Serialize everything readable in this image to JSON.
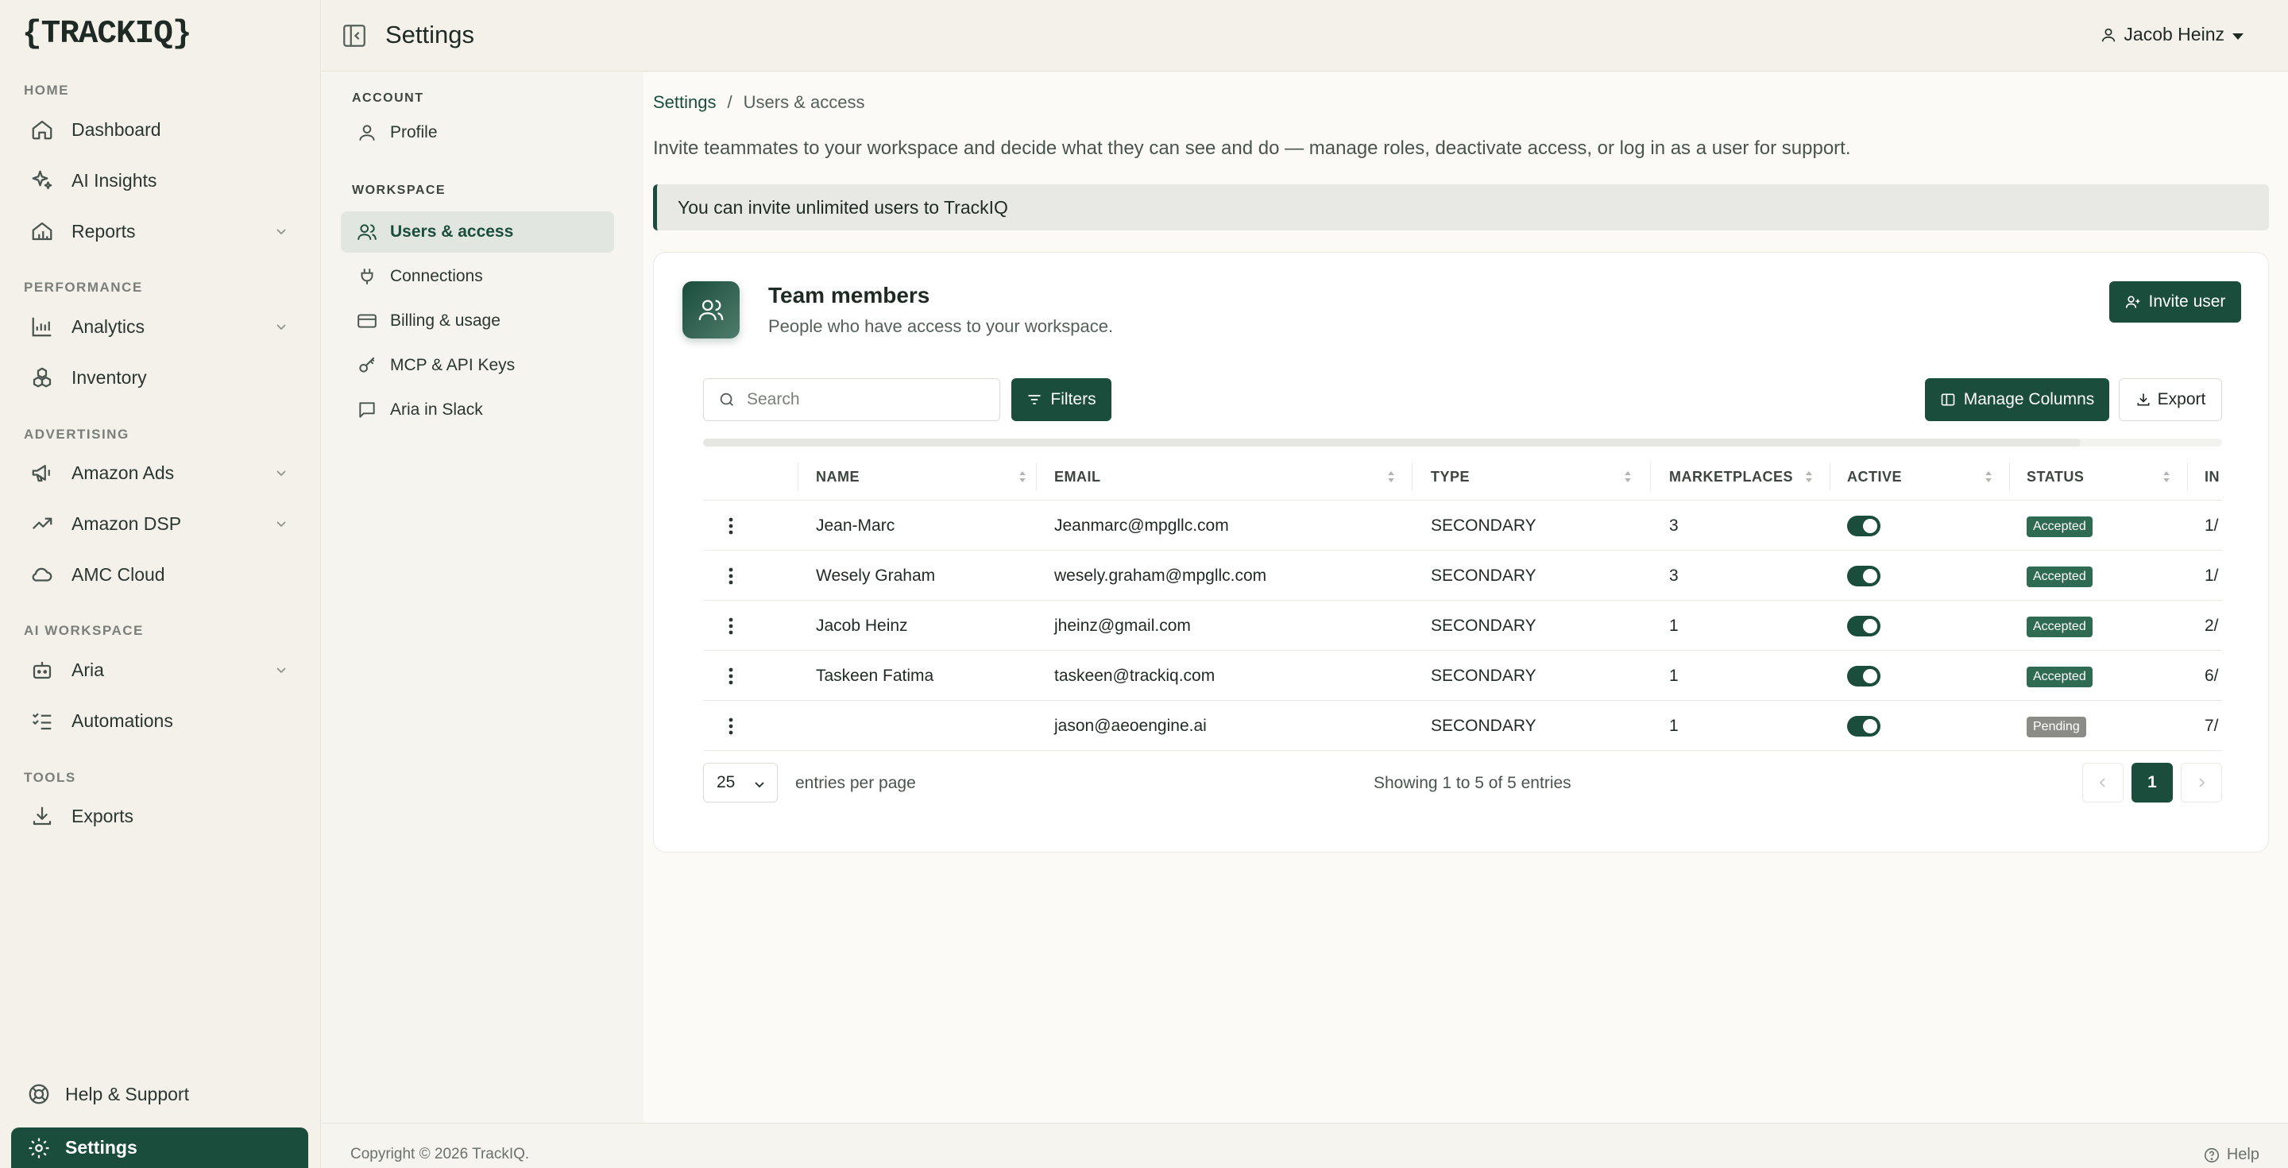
{
  "brand": {
    "logo": "{TRACKIQ}",
    "accent": "#1a4d3c"
  },
  "header": {
    "title": "Settings",
    "user_name": "Jacob Heinz"
  },
  "sidebar": {
    "sections": {
      "home": "HOME",
      "performance": "PERFORMANCE",
      "advertising": "ADVERTISING",
      "ai_workspace": "AI WORKSPACE",
      "tools": "TOOLS"
    },
    "items": {
      "dashboard": {
        "label": "Dashboard",
        "icon": "home-icon"
      },
      "ai_insights": {
        "label": "AI Insights",
        "icon": "sparkles-icon"
      },
      "reports": {
        "label": "Reports",
        "icon": "reports-icon"
      },
      "analytics": {
        "label": "Analytics",
        "icon": "chart-icon"
      },
      "inventory": {
        "label": "Inventory",
        "icon": "boxes-icon"
      },
      "amazon_ads": {
        "label": "Amazon Ads",
        "icon": "megaphone-icon"
      },
      "amazon_dsp": {
        "label": "Amazon DSP",
        "icon": "trending-icon"
      },
      "amc_cloud": {
        "label": "AMC Cloud",
        "icon": "cloud-icon"
      },
      "aria": {
        "label": "Aria",
        "icon": "bot-icon"
      },
      "automations": {
        "label": "Automations",
        "icon": "list-checks-icon"
      },
      "exports": {
        "label": "Exports",
        "icon": "download-icon"
      },
      "help_support": {
        "label": "Help & Support",
        "icon": "lifebuoy-icon"
      },
      "settings": {
        "label": "Settings",
        "icon": "gear-icon"
      }
    }
  },
  "settings_nav": {
    "sections": {
      "account": "ACCOUNT",
      "workspace": "WORKSPACE"
    },
    "items": {
      "profile": "Profile",
      "users_access": "Users & access",
      "connections": "Connections",
      "billing": "Billing & usage",
      "api_keys": "MCP & API Keys",
      "slack": "Aria in Slack"
    }
  },
  "breadcrumb": {
    "parent": "Settings",
    "sep": "/",
    "current": "Users & access"
  },
  "intro": "Invite teammates to your workspace and decide what they can see and do — manage roles, deactivate access, or log in as a user for support.",
  "alert": "You can invite unlimited users to TrackIQ",
  "card": {
    "title": "Team members",
    "subtitle": "People who have access to your workspace.",
    "invite_label": "Invite user",
    "search_placeholder": "Search",
    "filters_label": "Filters",
    "manage_columns_label": "Manage Columns",
    "export_label": "Export"
  },
  "table": {
    "headers": {
      "name": "NAME",
      "email": "EMAIL",
      "type": "TYPE",
      "marketplaces": "MARKETPLACES",
      "active": "ACTIVE",
      "status": "STATUS",
      "invited": "IN"
    },
    "rows": [
      {
        "name": "Jean-Marc",
        "email": "Jeanmarc@mpgllc.com",
        "type": "SECONDARY",
        "marketplaces": "3",
        "active": true,
        "status": "Accepted",
        "invited": "1/"
      },
      {
        "name": "Wesely Graham",
        "email": "wesely.graham@mpgllc.com",
        "type": "SECONDARY",
        "marketplaces": "3",
        "active": true,
        "status": "Accepted",
        "invited": "1/"
      },
      {
        "name": "Jacob Heinz",
        "email": "jheinz@gmail.com",
        "type": "SECONDARY",
        "marketplaces": "1",
        "active": true,
        "status": "Accepted",
        "invited": "2/"
      },
      {
        "name": "Taskeen Fatima",
        "email": "taskeen@trackiq.com",
        "type": "SECONDARY",
        "marketplaces": "1",
        "active": true,
        "status": "Accepted",
        "invited": "6/"
      },
      {
        "name": "",
        "email": "jason@aeoengine.ai",
        "type": "SECONDARY",
        "marketplaces": "1",
        "active": true,
        "status": "Pending",
        "invited": "7/"
      }
    ]
  },
  "pagination": {
    "per_page": "25",
    "per_page_label": "entries per page",
    "info": "Showing 1 to 5 of 5 entries",
    "current_page": "1"
  },
  "footer": {
    "copyright": "Copyright © 2026 TrackIQ.",
    "help": "Help"
  }
}
